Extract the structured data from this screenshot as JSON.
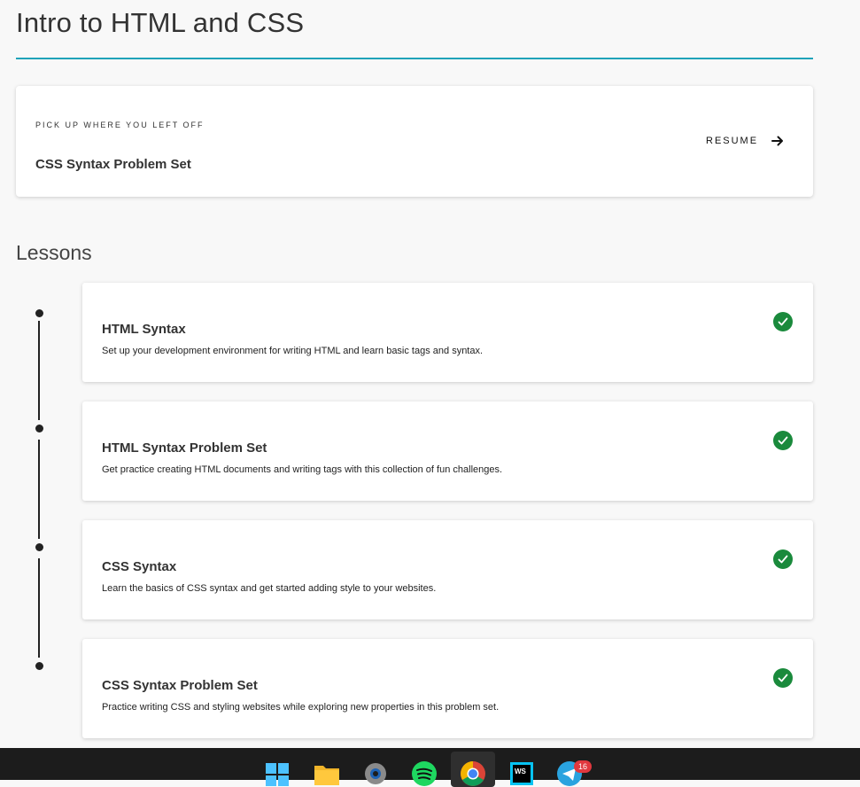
{
  "page": {
    "title": "Intro to HTML and CSS"
  },
  "resume": {
    "eyebrow": "PICK UP WHERE YOU LEFT OFF",
    "title": "CSS Syntax Problem Set",
    "button_label": "RESUME",
    "icon": "arrow-right-icon"
  },
  "lessons_section": {
    "title": "Lessons",
    "items": [
      {
        "title": "HTML Syntax",
        "description": "Set up your development environment for writing HTML and learn basic tags and syntax.",
        "status_icon": "check-circle-icon"
      },
      {
        "title": "HTML Syntax Problem Set",
        "description": "Get practice creating HTML documents and writing tags with this collection of fun challenges.",
        "status_icon": "check-circle-icon"
      },
      {
        "title": "CSS Syntax",
        "description": "Learn the basics of CSS syntax and get started adding style to your websites.",
        "status_icon": "check-circle-icon"
      },
      {
        "title": "CSS Syntax Problem Set",
        "description": "Practice writing CSS and styling websites while exploring new properties in this problem set.",
        "status_icon": "check-circle-icon"
      }
    ]
  },
  "taskbar": {
    "icons": [
      "windows-start-icon",
      "file-explorer-icon",
      "settings-icon",
      "spotify-icon",
      "chrome-icon",
      "webstorm-icon",
      "telegram-icon"
    ],
    "telegram_badge": "16"
  },
  "colors": {
    "accent_rule": "#1fa3b9",
    "complete_green": "#1a8a3c",
    "taskbar_bg": "#1c1c1c"
  }
}
